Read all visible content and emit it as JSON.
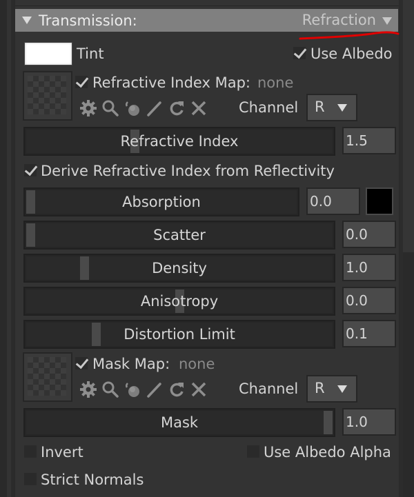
{
  "section": {
    "title": "Transmission:",
    "mode": "Refraction",
    "annotation_color": "#e00000"
  },
  "tint": {
    "label": "Tint",
    "color": "#ffffff"
  },
  "use_albedo": {
    "label": "Use Albedo",
    "checked": true
  },
  "refractive_index_map": {
    "label": "Refractive Index Map:",
    "value": "none",
    "checked": true,
    "tools": [
      "gear-icon",
      "search-icon",
      "material-ball-icon",
      "pencil-icon",
      "reload-icon",
      "close-icon"
    ],
    "channel_label": "Channel",
    "channel_value": "R"
  },
  "derive_ior": {
    "label": "Derive Refractive Index from Reflectivity",
    "checked": true
  },
  "sliders": [
    {
      "id": "refractive-index",
      "label": "Refractive Index",
      "value": "1.5",
      "handle_fraction": 0.35
    },
    {
      "id": "absorption",
      "label": "Absorption",
      "value": "0.0",
      "handle_fraction": 0.0,
      "color": "#000000"
    },
    {
      "id": "scatter",
      "label": "Scatter",
      "value": "0.0",
      "handle_fraction": 0.0
    },
    {
      "id": "density",
      "label": "Density",
      "value": "1.0",
      "handle_fraction": 0.18
    },
    {
      "id": "anisotropy",
      "label": "Anisotropy",
      "value": "0.0",
      "handle_fraction": 0.5
    },
    {
      "id": "distortion-limit",
      "label": "Distortion Limit",
      "value": "0.1",
      "handle_fraction": 0.22
    }
  ],
  "mask_map": {
    "label": "Mask Map:",
    "value": "none",
    "checked": true,
    "tools": [
      "gear-icon",
      "search-icon",
      "material-ball-icon",
      "pencil-icon",
      "reload-icon",
      "close-icon"
    ],
    "channel_label": "Channel",
    "channel_value": "R"
  },
  "mask_slider": {
    "label": "Mask",
    "value": "1.0",
    "handle_fraction": 1.0
  },
  "invert": {
    "label": "Invert",
    "checked": false
  },
  "use_albedo_alpha": {
    "label": "Use Albedo Alpha",
    "checked": false
  },
  "strict_normals": {
    "label": "Strict Normals",
    "checked": false
  }
}
